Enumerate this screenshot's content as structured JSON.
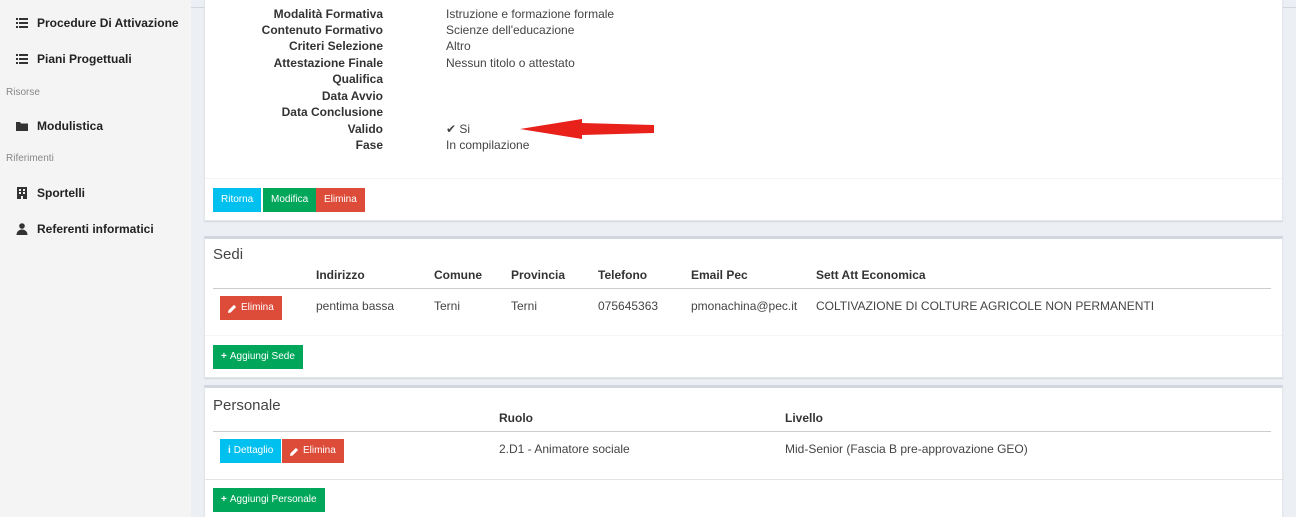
{
  "sidebar": {
    "items": [
      {
        "label": "Procedure Di Attivazione",
        "icon": "list-icon"
      },
      {
        "label": "Piani Progettuali",
        "icon": "list-icon"
      },
      {
        "header": "Risorse"
      },
      {
        "label": "Modulistica",
        "icon": "folder-icon"
      },
      {
        "header": "Riferimenti"
      },
      {
        "label": "Sportelli",
        "icon": "building-icon"
      },
      {
        "label": "Referenti informatici",
        "icon": "user-icon"
      }
    ]
  },
  "details": {
    "rows": [
      {
        "label": "Modalità Formativa",
        "value": "Istruzione e formazione formale"
      },
      {
        "label": "Contenuto Formativo",
        "value": "Scienze dell'educazione"
      },
      {
        "label": "Criteri Selezione",
        "value": "Altro"
      },
      {
        "label": "Attestazione Finale",
        "value": "Nessun titolo o attestato"
      },
      {
        "label": "Qualifica",
        "value": ""
      },
      {
        "label": "Data Avvio",
        "value": ""
      },
      {
        "label": "Data Conclusione",
        "value": ""
      },
      {
        "label": "Valido",
        "value": "Si"
      },
      {
        "label": "Fase",
        "value": "In compilazione"
      }
    ],
    "buttons": {
      "back": "Ritorna",
      "edit": "Modifica",
      "delete": "Elimina"
    },
    "annotation_color": "#e8211b"
  },
  "sedi": {
    "title": "Sedi",
    "columns": [
      "Indirizzo",
      "Comune",
      "Provincia",
      "Telefono",
      "Email Pec",
      "Sett Att Economica"
    ],
    "rows": [
      {
        "delete_label": "Elimina",
        "indirizzo": "pentima bassa",
        "comune": "Terni",
        "provincia": "Terni",
        "telefono": "075645363",
        "email": "pmonachina@pec.it",
        "settore": "COLTIVAZIONE DI COLTURE AGRICOLE NON PERMANENTI"
      }
    ],
    "add_label": "Aggiungi Sede"
  },
  "personale": {
    "title": "Personale",
    "columns": [
      "Ruolo",
      "Livello"
    ],
    "rows": [
      {
        "detail_label": "Dettaglio",
        "delete_label": "Elimina",
        "ruolo": "2.D1 - Animatore sociale",
        "livello": "Mid-Senior (Fascia B pre-approvazione GEO)"
      }
    ],
    "add_label": "Aggiungi Personale"
  },
  "colors": {
    "info": "#00c0ef",
    "success": "#00a65a",
    "danger": "#dd4b39"
  }
}
